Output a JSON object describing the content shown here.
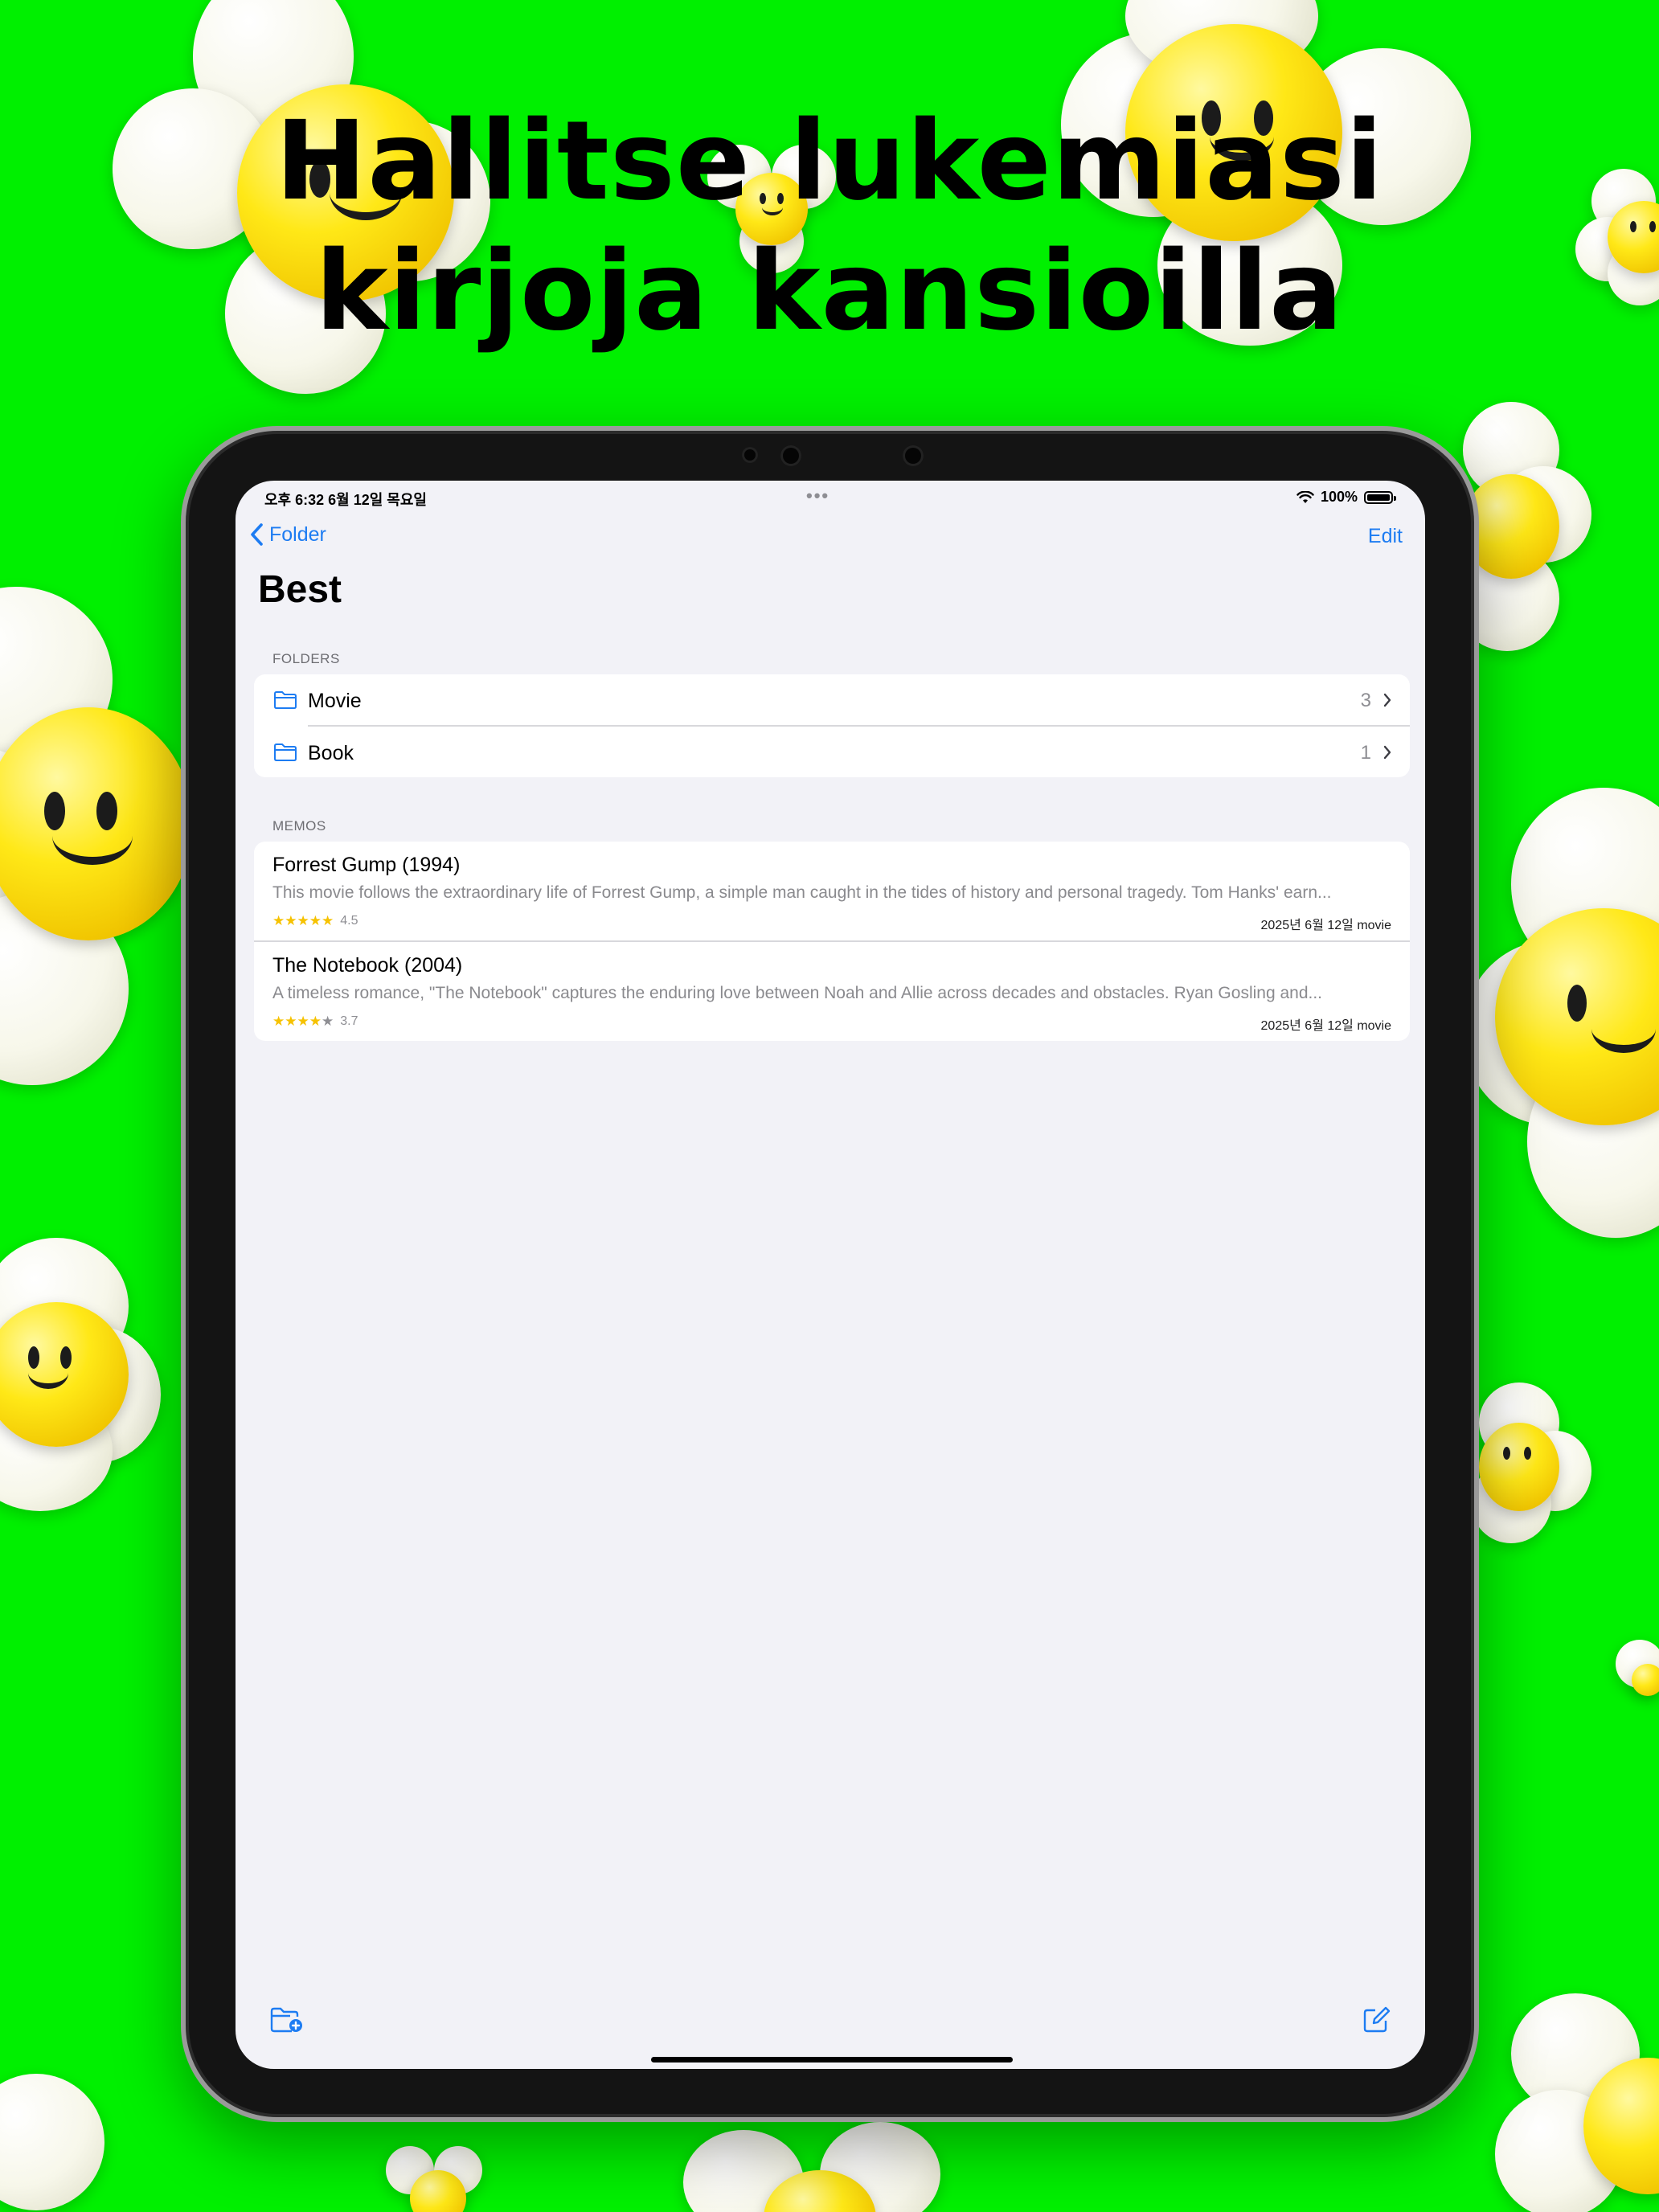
{
  "headline": {
    "line1": "Hallitse lukemiasi",
    "line2": "kirjoja kansioilla"
  },
  "status_bar": {
    "time_date": "오후 6:32   6월 12일 목요일",
    "dots": "•••",
    "battery": "100%"
  },
  "nav": {
    "back_label": "Folder",
    "edit_label": "Edit",
    "title": "Best"
  },
  "folders": {
    "header": "FOLDERS",
    "items": [
      {
        "name": "Movie",
        "count": "3"
      },
      {
        "name": "Book",
        "count": "1"
      }
    ]
  },
  "memos": {
    "header": "MEMOS",
    "items": [
      {
        "title": "Forrest Gump (1994)",
        "body": "This movie follows the extraordinary life of Forrest Gump, a simple man caught in the tides of history and personal tragedy. Tom Hanks' earn...",
        "rating": 4.5,
        "rating_label": "4.5",
        "meta": "2025년 6월 12일 movie"
      },
      {
        "title": "The Notebook (2004)",
        "body": "A timeless romance, \"The Notebook\" captures the enduring love between Noah and Allie across decades and obstacles. Ryan Gosling and...",
        "rating": 3.7,
        "rating_label": "3.7",
        "meta": "2025년 6월 12일 movie"
      }
    ]
  },
  "toolbar": {
    "left_icon": "new-folder-icon",
    "right_icon": "compose-icon"
  },
  "colors": {
    "background": "#00f000",
    "accent": "#1d7cf2",
    "star": "#f6c200"
  }
}
